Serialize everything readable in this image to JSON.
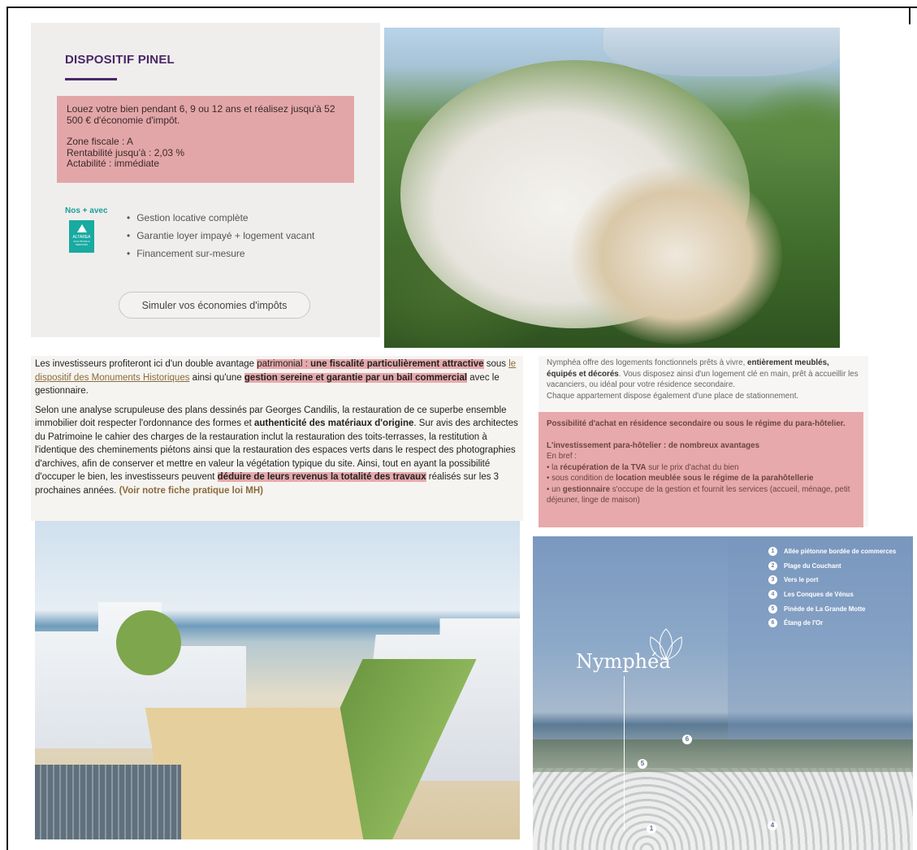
{
  "pinel": {
    "title": "DISPOSITIF PINEL",
    "intro": "Louez votre bien pendant 6, 9 ou 12 ans et réalisez jusqu'à 52 500 € d'économie d'impôt.",
    "zone": "Zone fiscale : A",
    "rentabilite": "Rentabilité jusqu'à : 2,03 %",
    "actabilite": "Actabilité : immédiate",
    "nos_avec": "Nos + avec",
    "logo_text": "ALTAREA",
    "logo_sub": "SOLUTIONS & SERVICES",
    "features": [
      "Gestion locative complète",
      "Garantie loyer impayé + logement vacant",
      "Financement sur-mesure"
    ],
    "button": "Simuler vos économies d'impôts"
  },
  "left_text": {
    "p1_a": "Les investisseurs profiteront ici d'un double avantage ",
    "p1_hl1": "patrimonial : ",
    "p1_b": "une fiscalité particulièrement attractive",
    "p1_c": " sous ",
    "p1_link": "le dispositif des Monuments Historiques",
    "p1_d": " ainsi qu'une ",
    "p1_e": "gestion sereine et garantie par un bail commercial",
    "p1_f": " avec le gestionnaire.",
    "p2_a": "Selon une analyse scrupuleuse des plans dessinés par Georges Candilis, la restauration de ce superbe ensemble immobilier doit respecter l'ordonnance des formes et ",
    "p2_b": "authenticité des matériaux d'origine",
    "p2_c": ". Sur avis des architectes du Patrimoine le cahier des charges de la restauration inclut la restauration des toits-terrasses, la restitution à l'identique des cheminements piétons ainsi que la restauration des espaces verts dans le respect des photographies d'archives, afin de conserver et mettre en valeur la végétation typique du site. Ainsi, tout en ayant la possibilité d'occuper le bien, les investisseurs peuvent ",
    "p2_d": "déduire de leurs revenus la totalité des travaux",
    "p2_e": " réalisés sur les 3 prochaines années. ",
    "p2_link": "(Voir notre fiche pratique loi MH)"
  },
  "right_text": {
    "p1_a": "Nymphéa offre des logements fonctionnels prêts à vivre, ",
    "p1_b": "entièrement meublés, équipés et décorés",
    "p1_c": ". Vous disposez ainsi d'un logement clé en main, prêt à accueillir les vacanciers, ou idéal pour votre résidence secondaire.",
    "p2": "Chaque appartement dispose également d'une place de stationnement.",
    "pink_title": "Possibilité d'achat en résidence secondaire ou sous le régime du para-hôtelier.",
    "pink_sub": "L'investissement para-hôtelier : de nombreux avantages",
    "en_bref": "En bref :",
    "b1_a": "• la ",
    "b1_b": "récupération de la TVA",
    "b1_c": " sur le prix d'achat du bien",
    "b2_a": "• sous condition de ",
    "b2_b": "location meublée sous le régime de la parahôtellerie",
    "b3_a": "• un ",
    "b3_b": "gestionnaire",
    "b3_c": " s'occupe de la gestion et fournit les services (accueil, ménage, petit déjeuner, linge de maison)"
  },
  "map": {
    "logo": "Nymphéa",
    "legend": [
      {
        "n": "1",
        "label": "Allée piétonne bordée de commerces"
      },
      {
        "n": "2",
        "label": "Plage du Couchant"
      },
      {
        "n": "3",
        "label": "Vers le port"
      },
      {
        "n": "4",
        "label": "Les Conques de Vénus"
      },
      {
        "n": "5",
        "label": "Pinède de La Grande Motte"
      },
      {
        "n": "6",
        "label": "Étang de l'Or"
      }
    ],
    "markers": [
      "6",
      "5",
      "1",
      "4"
    ]
  }
}
